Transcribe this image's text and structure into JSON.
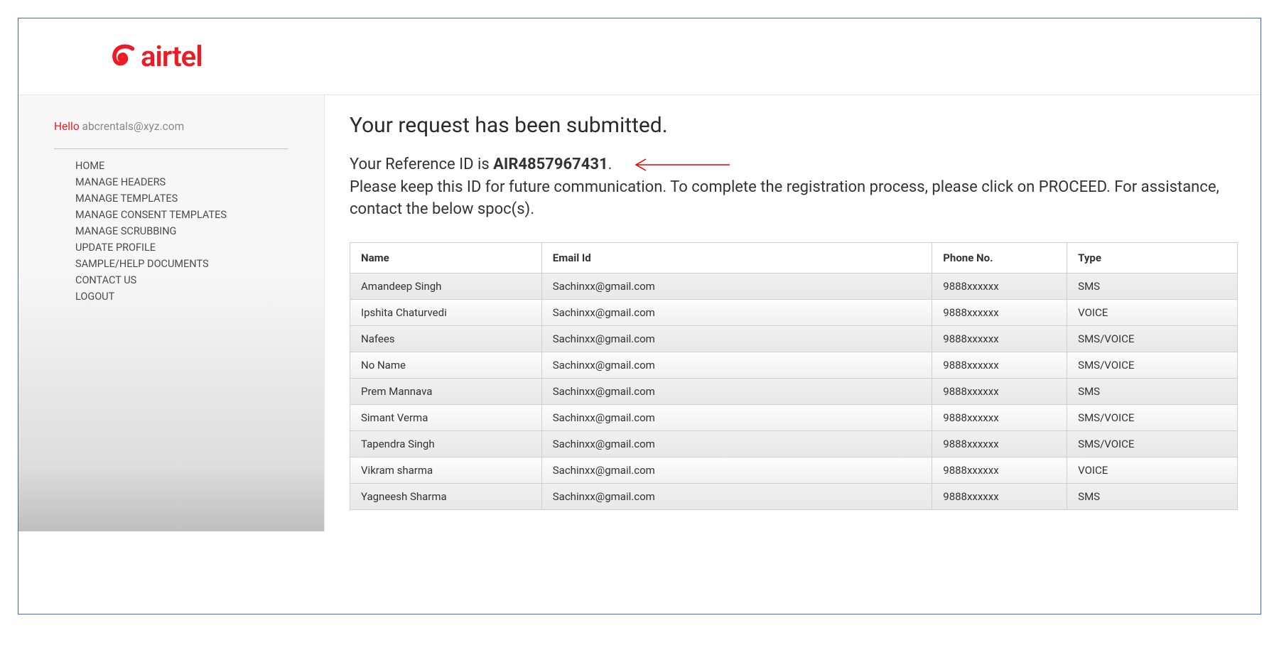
{
  "brand": {
    "name": "airtel"
  },
  "sidebar": {
    "greeting": "Hello",
    "email": "abcrentals@xyz.com",
    "items": [
      {
        "label": "HOME"
      },
      {
        "label": "MANAGE HEADERS"
      },
      {
        "label": "MANAGE TEMPLATES"
      },
      {
        "label": "MANAGE CONSENT TEMPLATES"
      },
      {
        "label": "MANAGE SCRUBBING"
      },
      {
        "label": "UPDATE PROFILE"
      },
      {
        "label": "SAMPLE/HELP DOCUMENTS"
      },
      {
        "label": "CONTACT US"
      },
      {
        "label": "LOGOUT"
      }
    ]
  },
  "main": {
    "heading": "Your request has been submitted.",
    "ref_prefix": "Your Reference ID is ",
    "ref_id": "AIR4857967431",
    "ref_suffix": ".",
    "instruction": "Please keep this ID for future communication. To complete the registration process, please click on PROCEED. For assistance, contact the below spoc(s).",
    "table": {
      "headers": {
        "name": "Name",
        "email": "Email Id",
        "phone": "Phone No.",
        "type": "Type"
      },
      "rows": [
        {
          "name": "Amandeep Singh",
          "email": "Sachinxx@gmail.com",
          "phone": "9888xxxxxx",
          "type": "SMS"
        },
        {
          "name": "Ipshita Chaturvedi",
          "email": "Sachinxx@gmail.com",
          "phone": "9888xxxxxx",
          "type": "VOICE"
        },
        {
          "name": "Nafees",
          "email": "Sachinxx@gmail.com",
          "phone": "9888xxxxxx",
          "type": "SMS/VOICE"
        },
        {
          "name": "No Name",
          "email": "Sachinxx@gmail.com",
          "phone": "9888xxxxxx",
          "type": "SMS/VOICE"
        },
        {
          "name": "Prem Mannava",
          "email": "Sachinxx@gmail.com",
          "phone": "9888xxxxxx",
          "type": "SMS"
        },
        {
          "name": "Simant Verma",
          "email": "Sachinxx@gmail.com",
          "phone": "9888xxxxxx",
          "type": "SMS/VOICE"
        },
        {
          "name": "Tapendra Singh",
          "email": "Sachinxx@gmail.com",
          "phone": "9888xxxxxx",
          "type": "SMS/VOICE"
        },
        {
          "name": "Vikram sharma",
          "email": "Sachinxx@gmail.com",
          "phone": "9888xxxxxx",
          "type": "VOICE"
        },
        {
          "name": "Yagneesh Sharma",
          "email": "Sachinxx@gmail.com",
          "phone": "9888xxxxxx",
          "type": "SMS"
        }
      ]
    }
  }
}
